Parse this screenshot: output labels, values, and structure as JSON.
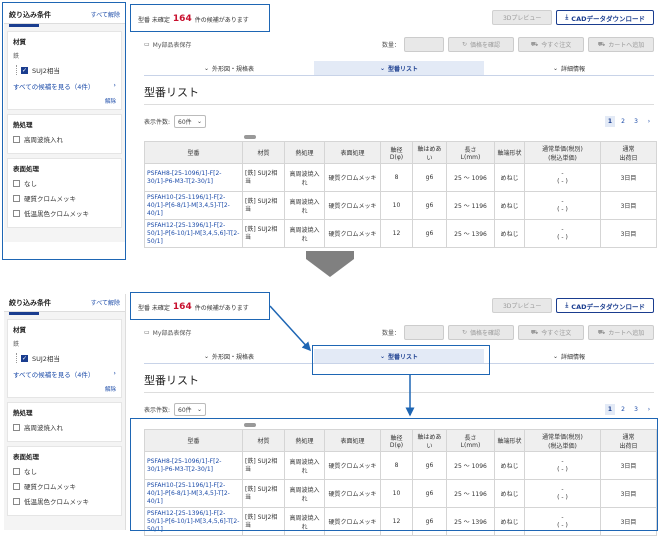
{
  "sidebar": {
    "title": "絞り込み条件",
    "clear_all": "すべて解除",
    "material": {
      "title": "材質",
      "sub": "鉄",
      "option": "SUJ2相当",
      "see_all": "すべての候補を見る（4件）",
      "clear": "解除"
    },
    "heat": {
      "title": "熱処理",
      "option": "高周波焼入れ"
    },
    "surface": {
      "title": "表面処理",
      "options": [
        "なし",
        "硬質クロムメッキ",
        "低温黒色クロムメッキ"
      ]
    }
  },
  "header": {
    "count_prefix": "型番 未確定",
    "count": "164",
    "count_suffix": "件の候補があります",
    "preview_button": "3Dプレビュー",
    "cad_button": "CADデータダウンロード"
  },
  "toolbar": {
    "mypart": "My部品表保存",
    "qty_label": "数量：",
    "price_button": "価格を確認",
    "order_button": "今すぐ注文",
    "cart_button": "カートへ追加"
  },
  "tabs": [
    {
      "label": "外形図・規格表"
    },
    {
      "label": "型番リスト"
    },
    {
      "label": "詳細情報"
    }
  ],
  "list": {
    "title": "型番リスト",
    "display_label": "表示件数:",
    "display_value": "60件",
    "pages": [
      "1",
      "2",
      "3"
    ]
  },
  "table": {
    "headers": [
      "型番",
      "材質",
      "熱処理",
      "表面処理",
      "軸径 D(φ)",
      "軸はめあい",
      "長さ L(mm)",
      "軸端形状",
      "通常単価(税別) (税込単価)",
      "通常 出荷日"
    ],
    "header_price_top": "通常単価(税別)",
    "header_price_bottom": "(税込単価)",
    "header_ship_top": "通常",
    "header_ship_bottom": "出荷日",
    "header_length_top": "長さ",
    "header_length_bottom": "L(mm)",
    "rows": [
      {
        "pn1": "PSFAH8-[25-1096/1]-F[2-",
        "pn2": "30/1]-P6-M3-T[2-30/1]",
        "mat1": "[鉄] SUJ2相",
        "mat2": "当",
        "heat": "高周波焼入れ",
        "surface": "硬質クロムメッキ",
        "d": "8",
        "fit": "g6",
        "len": "25 ～ 1096",
        "end": "めねじ",
        "price": "-",
        "price_tax": "( - )",
        "ship": "3日目"
      },
      {
        "pn1": "PSFAH10-[25-1196/1]-F[2-",
        "pn2": "40/1]-P[6-8/1]-M[3,4,5]-T[2-40/1]",
        "mat1": "[鉄] SUJ2相",
        "mat2": "当",
        "heat": "高周波焼入れ",
        "surface": "硬質クロムメッキ",
        "d": "10",
        "fit": "g6",
        "len": "25 ～ 1196",
        "end": "めねじ",
        "price": "-",
        "price_tax": "( - )",
        "ship": "3日目"
      },
      {
        "pn1": "PSFAH12-[25-1396/1]-F[2-",
        "pn2": "50/1]-P[6-10/1]-M[3,4,5,6]-T[2-50/1]",
        "mat1": "[鉄] SUJ2相",
        "mat2": "当",
        "heat": "高周波焼入れ",
        "surface": "硬質クロムメッキ",
        "d": "12",
        "fit": "g6",
        "len": "25 ～ 1396",
        "end": "めねじ",
        "price": "-",
        "price_tax": "( - )",
        "ship": "3日目"
      }
    ]
  },
  "colors": {
    "accent": "#1a3d8f",
    "highlight": "#1e66b4",
    "count": "#c8102e",
    "link": "#1a4aa8"
  }
}
